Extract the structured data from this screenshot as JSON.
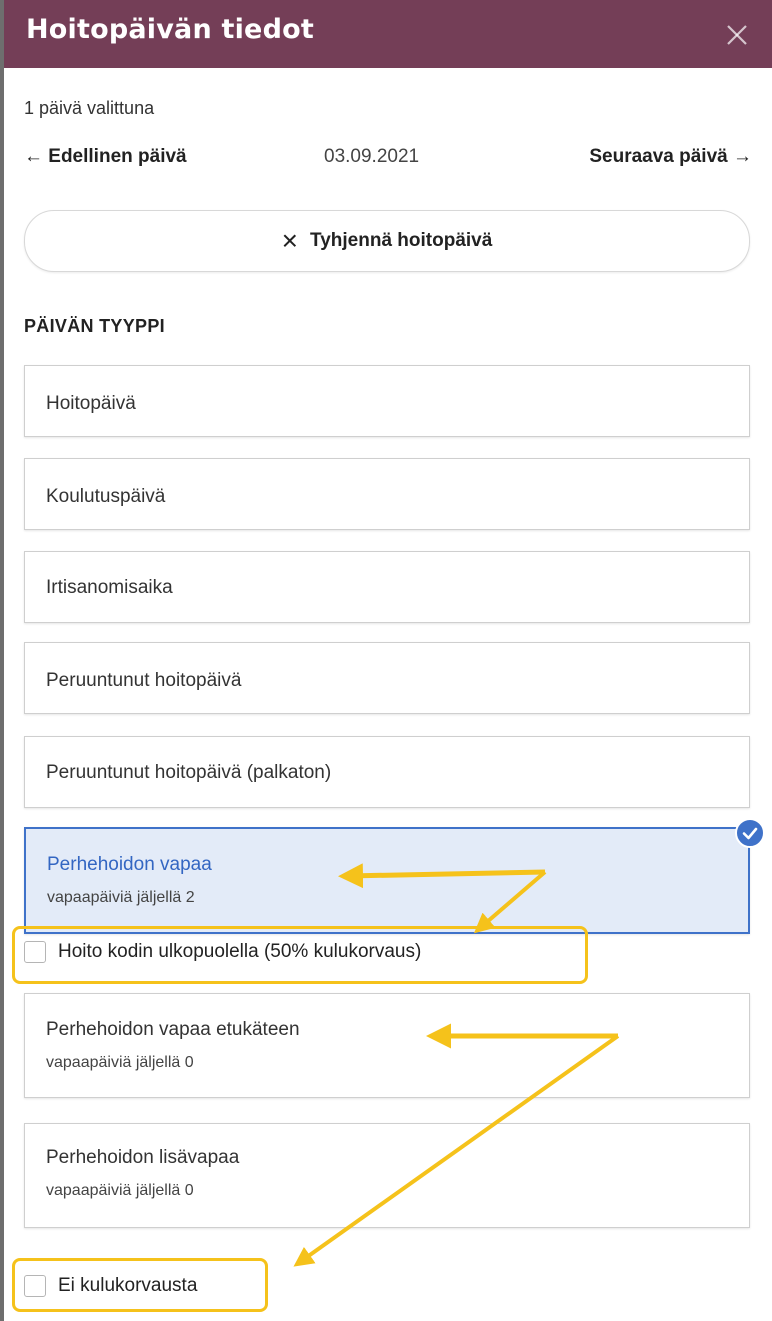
{
  "header": {
    "title": "Hoitopäivän tiedot",
    "close_icon": "close-icon"
  },
  "selection": {
    "count_text": "1 päivä valittuna"
  },
  "navigation": {
    "prev_label": "← Edellinen päivä",
    "date": "03.09.2021",
    "next_label": "Seuraava päivä →"
  },
  "clear_button": {
    "icon": "×",
    "label": "Tyhjennä hoitopäivä"
  },
  "section": {
    "title": "PÄIVÄN TYYPPI"
  },
  "options": [
    {
      "label": "Hoitopäivä",
      "sub": "",
      "selected": false
    },
    {
      "label": "Koulutuspäivä",
      "sub": "",
      "selected": false
    },
    {
      "label": "Irtisanomisaika",
      "sub": "",
      "selected": false
    },
    {
      "label": "Peruuntunut hoitopäivä",
      "sub": "",
      "selected": false
    },
    {
      "label": "Peruuntunut hoitopäivä (palkaton)",
      "sub": "",
      "selected": false
    },
    {
      "label": "Perhehoidon vapaa",
      "sub": "vapaapäiviä jäljellä 2",
      "selected": true
    },
    {
      "label": "Perhehoidon vapaa etukäteen",
      "sub": "vapaapäiviä jäljellä 0",
      "selected": false
    },
    {
      "label": "Perhehoidon lisävapaa",
      "sub": "vapaapäiviä jäljellä 0",
      "selected": false
    }
  ],
  "checkboxes": [
    {
      "label": "Hoito kodin ulkopuolella (50% kulukorvaus)",
      "checked": false
    },
    {
      "label": "Ei kulukorvausta",
      "checked": false
    }
  ],
  "colors": {
    "header_bg": "#743e57",
    "selected_bg": "#e3ebf8",
    "selected_border": "#3f72c9",
    "highlight": "#f5c21b"
  }
}
